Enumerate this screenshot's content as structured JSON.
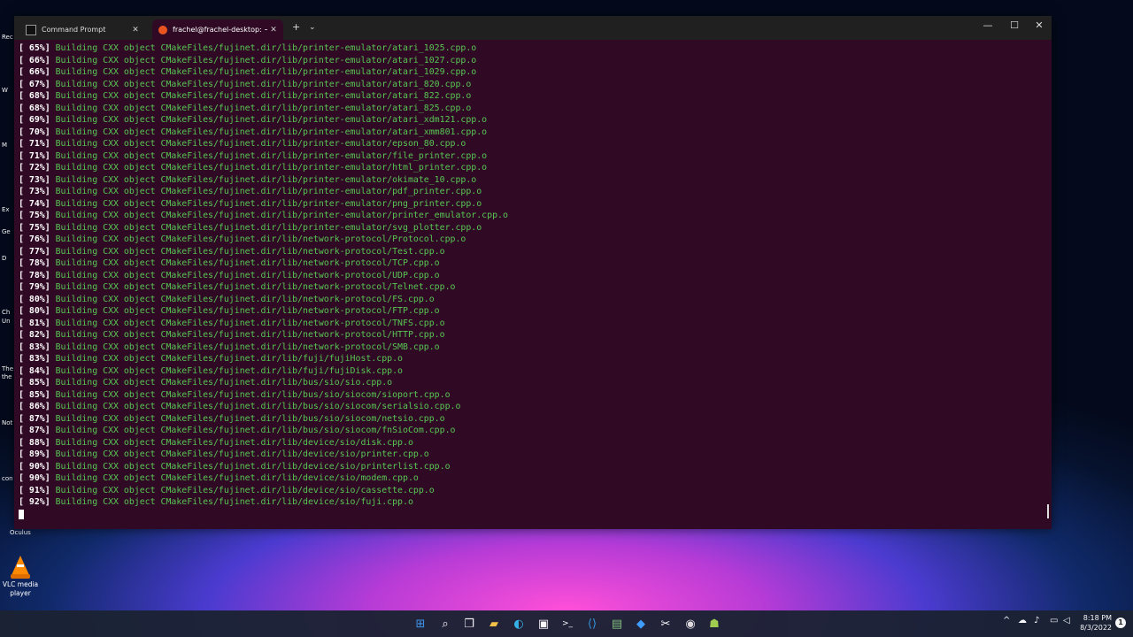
{
  "desktop": {
    "fragments": [
      "Rec",
      "W",
      "M",
      "Ex",
      "Ge",
      "D",
      "Ch",
      "Un",
      "The",
      "the",
      "Not",
      "con",
      "Oculus"
    ],
    "vlc_label": "VLC media player"
  },
  "tabs": [
    {
      "label": "Command Prompt"
    },
    {
      "label": "frachel@frachel-desktop: ~/fu"
    }
  ],
  "terminal": {
    "lines": [
      {
        "pct": "[ 65%]",
        "text": " Building CXX object CMakeFiles/fujinet.dir/lib/printer-emulator/atari_1025.cpp.o"
      },
      {
        "pct": "[ 66%]",
        "text": " Building CXX object CMakeFiles/fujinet.dir/lib/printer-emulator/atari_1027.cpp.o"
      },
      {
        "pct": "[ 66%]",
        "text": " Building CXX object CMakeFiles/fujinet.dir/lib/printer-emulator/atari_1029.cpp.o"
      },
      {
        "pct": "[ 67%]",
        "text": " Building CXX object CMakeFiles/fujinet.dir/lib/printer-emulator/atari_820.cpp.o"
      },
      {
        "pct": "[ 68%]",
        "text": " Building CXX object CMakeFiles/fujinet.dir/lib/printer-emulator/atari_822.cpp.o"
      },
      {
        "pct": "[ 68%]",
        "text": " Building CXX object CMakeFiles/fujinet.dir/lib/printer-emulator/atari_825.cpp.o"
      },
      {
        "pct": "[ 69%]",
        "text": " Building CXX object CMakeFiles/fujinet.dir/lib/printer-emulator/atari_xdm121.cpp.o"
      },
      {
        "pct": "[ 70%]",
        "text": " Building CXX object CMakeFiles/fujinet.dir/lib/printer-emulator/atari_xmm801.cpp.o"
      },
      {
        "pct": "[ 71%]",
        "text": " Building CXX object CMakeFiles/fujinet.dir/lib/printer-emulator/epson_80.cpp.o"
      },
      {
        "pct": "[ 71%]",
        "text": " Building CXX object CMakeFiles/fujinet.dir/lib/printer-emulator/file_printer.cpp.o"
      },
      {
        "pct": "[ 72%]",
        "text": " Building CXX object CMakeFiles/fujinet.dir/lib/printer-emulator/html_printer.cpp.o"
      },
      {
        "pct": "[ 73%]",
        "text": " Building CXX object CMakeFiles/fujinet.dir/lib/printer-emulator/okimate_10.cpp.o"
      },
      {
        "pct": "[ 73%]",
        "text": " Building CXX object CMakeFiles/fujinet.dir/lib/printer-emulator/pdf_printer.cpp.o"
      },
      {
        "pct": "[ 74%]",
        "text": " Building CXX object CMakeFiles/fujinet.dir/lib/printer-emulator/png_printer.cpp.o"
      },
      {
        "pct": "[ 75%]",
        "text": " Building CXX object CMakeFiles/fujinet.dir/lib/printer-emulator/printer_emulator.cpp.o"
      },
      {
        "pct": "[ 75%]",
        "text": " Building CXX object CMakeFiles/fujinet.dir/lib/printer-emulator/svg_plotter.cpp.o"
      },
      {
        "pct": "[ 76%]",
        "text": " Building CXX object CMakeFiles/fujinet.dir/lib/network-protocol/Protocol.cpp.o"
      },
      {
        "pct": "[ 77%]",
        "text": " Building CXX object CMakeFiles/fujinet.dir/lib/network-protocol/Test.cpp.o"
      },
      {
        "pct": "[ 78%]",
        "text": " Building CXX object CMakeFiles/fujinet.dir/lib/network-protocol/TCP.cpp.o"
      },
      {
        "pct": "[ 78%]",
        "text": " Building CXX object CMakeFiles/fujinet.dir/lib/network-protocol/UDP.cpp.o"
      },
      {
        "pct": "[ 79%]",
        "text": " Building CXX object CMakeFiles/fujinet.dir/lib/network-protocol/Telnet.cpp.o"
      },
      {
        "pct": "[ 80%]",
        "text": " Building CXX object CMakeFiles/fujinet.dir/lib/network-protocol/FS.cpp.o"
      },
      {
        "pct": "[ 80%]",
        "text": " Building CXX object CMakeFiles/fujinet.dir/lib/network-protocol/FTP.cpp.o"
      },
      {
        "pct": "[ 81%]",
        "text": " Building CXX object CMakeFiles/fujinet.dir/lib/network-protocol/TNFS.cpp.o"
      },
      {
        "pct": "[ 82%]",
        "text": " Building CXX object CMakeFiles/fujinet.dir/lib/network-protocol/HTTP.cpp.o"
      },
      {
        "pct": "[ 83%]",
        "text": " Building CXX object CMakeFiles/fujinet.dir/lib/network-protocol/SMB.cpp.o"
      },
      {
        "pct": "[ 83%]",
        "text": " Building CXX object CMakeFiles/fujinet.dir/lib/fuji/fujiHost.cpp.o"
      },
      {
        "pct": "[ 84%]",
        "text": " Building CXX object CMakeFiles/fujinet.dir/lib/fuji/fujiDisk.cpp.o"
      },
      {
        "pct": "[ 85%]",
        "text": " Building CXX object CMakeFiles/fujinet.dir/lib/bus/sio/sio.cpp.o"
      },
      {
        "pct": "[ 85%]",
        "text": " Building CXX object CMakeFiles/fujinet.dir/lib/bus/sio/siocom/sioport.cpp.o"
      },
      {
        "pct": "[ 86%]",
        "text": " Building CXX object CMakeFiles/fujinet.dir/lib/bus/sio/siocom/serialsio.cpp.o"
      },
      {
        "pct": "[ 87%]",
        "text": " Building CXX object CMakeFiles/fujinet.dir/lib/bus/sio/siocom/netsio.cpp.o"
      },
      {
        "pct": "[ 87%]",
        "text": " Building CXX object CMakeFiles/fujinet.dir/lib/bus/sio/siocom/fnSioCom.cpp.o"
      },
      {
        "pct": "[ 88%]",
        "text": " Building CXX object CMakeFiles/fujinet.dir/lib/device/sio/disk.cpp.o"
      },
      {
        "pct": "[ 89%]",
        "text": " Building CXX object CMakeFiles/fujinet.dir/lib/device/sio/printer.cpp.o"
      },
      {
        "pct": "[ 90%]",
        "text": " Building CXX object CMakeFiles/fujinet.dir/lib/device/sio/printerlist.cpp.o"
      },
      {
        "pct": "[ 90%]",
        "text": " Building CXX object CMakeFiles/fujinet.dir/lib/device/sio/modem.cpp.o"
      },
      {
        "pct": "[ 91%]",
        "text": " Building CXX object CMakeFiles/fujinet.dir/lib/device/sio/cassette.cpp.o"
      },
      {
        "pct": "[ 92%]",
        "text": " Building CXX object CMakeFiles/fujinet.dir/lib/device/sio/fuji.cpp.o"
      }
    ]
  },
  "taskbar": {
    "icons": [
      "windows-start-icon",
      "search-icon",
      "task-view-icon",
      "file-explorer-icon",
      "edge-icon",
      "store-icon",
      "terminal-icon",
      "vscode-icon",
      "notepad-icon",
      "app-icon",
      "snipping-icon",
      "chrome-icon",
      "android-icon"
    ],
    "time": "8:18 PM",
    "date": "8/3/2022",
    "notification_count": "1"
  },
  "colors": {
    "terminal_bg": "#300a24",
    "build_text": "#57c754",
    "percent_text": "#ffffff",
    "titlebar": "#202020"
  }
}
